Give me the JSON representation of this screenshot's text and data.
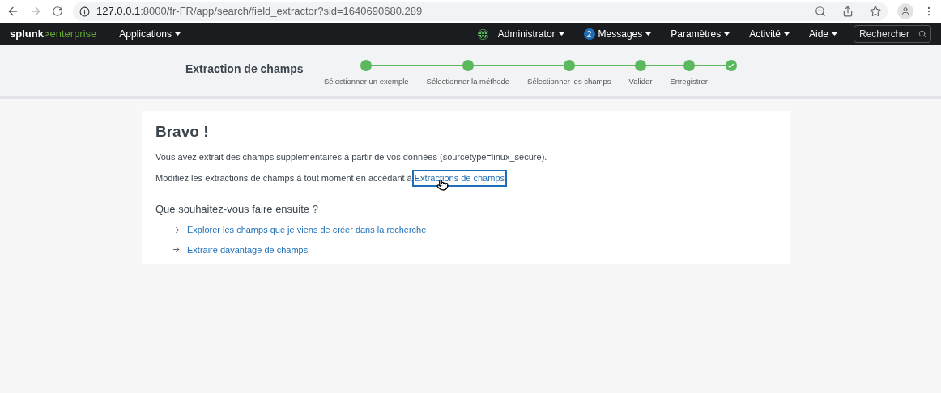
{
  "browser": {
    "url_host": "127.0.0.1",
    "url_rest": ":8000/fr-FR/app/search/field_extractor?sid=1640690680.289"
  },
  "navbar": {
    "logo_left": "splunk",
    "logo_right": ">enterprise",
    "apps_menu": "Applications",
    "menus": [
      {
        "kind": "user",
        "label": "Administrator"
      },
      {
        "kind": "messages",
        "label": "Messages",
        "badge": "2"
      },
      {
        "kind": "plain",
        "label": "Paramètres"
      },
      {
        "kind": "plain",
        "label": "Activité"
      },
      {
        "kind": "plain",
        "label": "Aide"
      }
    ],
    "search": {
      "placeholder": "Rechercher"
    }
  },
  "wizard": {
    "title": "Extraction de champs",
    "steps": [
      {
        "label": "Sélectionner un exemple",
        "completed": true,
        "kind": "dot"
      },
      {
        "label": "Sélectionner la méthode",
        "completed": true,
        "kind": "dot"
      },
      {
        "label": "Sélectionner les champs",
        "completed": true,
        "kind": "dot"
      },
      {
        "label": "Valider",
        "completed": true,
        "kind": "dot"
      },
      {
        "label": "Enregistrer",
        "completed": true,
        "kind": "dot"
      },
      {
        "completed": true,
        "kind": "check"
      }
    ]
  },
  "card": {
    "title": "Bravo !",
    "message": "Vous avez extrait des champs supplémentaires à partir de vos données (sourcetype=linux_secure).",
    "modify_text": "Modifiez les extractions de champs à tout moment en accédant à",
    "modify_link": {
      "label": "Extractions de champs",
      "focused": true
    },
    "next_heading": "Que souhaitez-vous faire ensuite ?",
    "next_links": [
      "Explorer les champs que je viens de créer dans la recherche",
      "Extraire davantage de champs"
    ]
  }
}
